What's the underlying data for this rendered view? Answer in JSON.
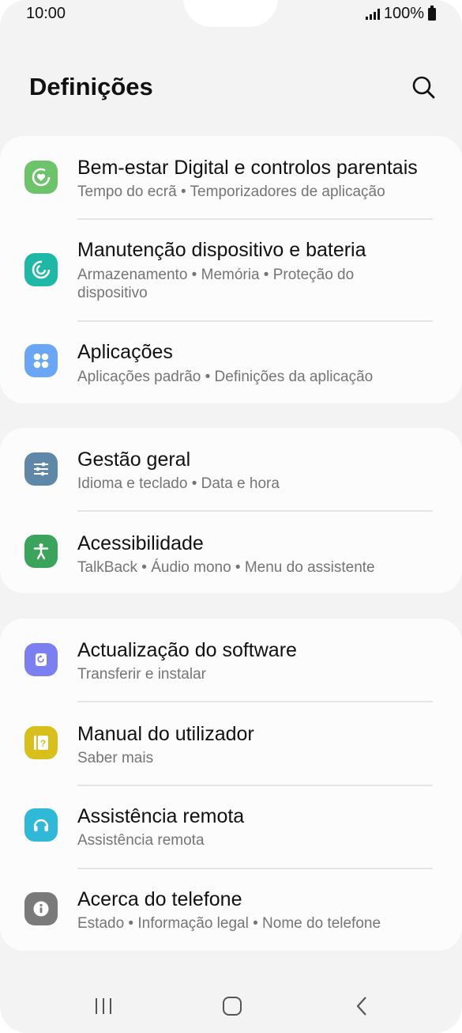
{
  "status_bar": {
    "time": "10:00",
    "battery": "100%"
  },
  "header": {
    "title": "Definições",
    "search_icon": "search-icon"
  },
  "groups": [
    {
      "items": [
        {
          "title": "Bem-estar Digital e controlos parentais",
          "subtitle": "Tempo do ecrã  •  Temporizadores de aplicação",
          "icon": "digital-wellbeing-icon",
          "color": "#6cc36a"
        },
        {
          "title": "Manutenção dispositivo e bateria",
          "subtitle": "Armazenamento  •  Memória  •  Proteção do dispositivo",
          "icon": "device-care-icon",
          "color": "#1fb7a5"
        },
        {
          "title": "Aplicações",
          "subtitle": "Aplicações padrão  •  Definições da aplicação",
          "icon": "apps-icon",
          "color": "#6aa6f5"
        }
      ]
    },
    {
      "items": [
        {
          "title": "Gestão geral",
          "subtitle": "Idioma e teclado  •  Data e hora",
          "icon": "sliders-icon",
          "color": "#5f88a8"
        },
        {
          "title": "Acessibilidade",
          "subtitle": "TalkBack  •  Áudio mono  •  Menu do assistente",
          "icon": "accessibility-icon",
          "color": "#3aa35c"
        }
      ]
    },
    {
      "items": [
        {
          "title": "Actualização do software",
          "subtitle": "Transferir e instalar",
          "icon": "software-update-icon",
          "color": "#7b7ff0"
        },
        {
          "title": "Manual do utilizador",
          "subtitle": "Saber mais",
          "icon": "user-manual-icon",
          "color": "#d8bf1c"
        },
        {
          "title": "Assistência remota",
          "subtitle": "Assistência remota",
          "icon": "headset-icon",
          "color": "#2fb8d8"
        },
        {
          "title": "Acerca do telefone",
          "subtitle": "Estado  •  Informação legal  •  Nome do telefone",
          "icon": "info-icon",
          "color": "#7a7a7a"
        }
      ]
    }
  ],
  "navbar": {
    "recents": "recents-icon",
    "home": "home-icon",
    "back": "back-icon"
  }
}
